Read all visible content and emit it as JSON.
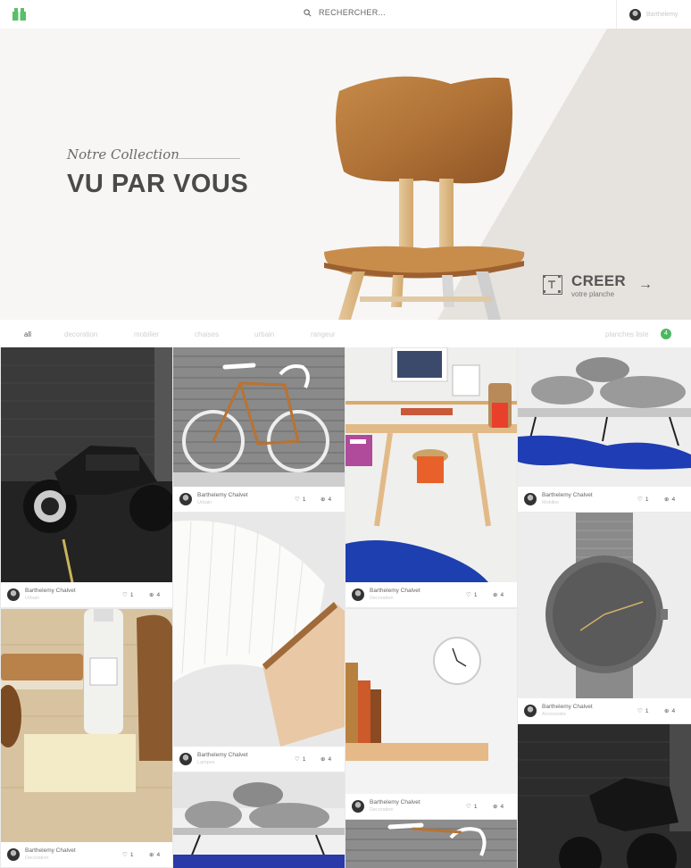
{
  "header": {
    "search_label": "RECHERCHER...",
    "user_name": "Barthelemy",
    "icons": {
      "logo": "gift-logo-icon",
      "search": "search-icon",
      "avatar": "user-avatar"
    }
  },
  "hero": {
    "subtitle": "Notre Collection",
    "title": "VU PAR VOUS",
    "cta_title": "CREER",
    "cta_subtitle": "votre planche",
    "cta_arrow": "→"
  },
  "filters": {
    "items": [
      "all",
      "decoration",
      "mobilier",
      "chaises",
      "urbain",
      "rangeur"
    ],
    "active": "all",
    "boards_label": "planches liste",
    "boards_count": "4"
  },
  "colors": {
    "accent_green": "#4cb85f",
    "hero_bg": "#f7f6f5",
    "hero_triangle": "#e6e3df"
  },
  "cards": [
    {
      "image": "black motorcycle in dark garage",
      "author": "Barthelemy Chalvet",
      "category": "Urbain",
      "likes": "1",
      "pins": "4"
    },
    {
      "image": "copper fixie bicycle",
      "author": "Barthelemy Chalvet",
      "category": "Urbain",
      "likes": "1",
      "pins": "4"
    },
    {
      "image": "wooden desk with stool",
      "author": "Barthelemy Chalvet",
      "category": "Decoration",
      "likes": "1",
      "pins": "4"
    },
    {
      "image": "pebble shaped sofa on blue rug",
      "author": "Barthelemy Chalvet",
      "category": "Mobilier",
      "likes": "1",
      "pins": "4"
    },
    {
      "image": "grooming brushes and bottle",
      "author": "Barthelemy Chalvet",
      "category": "Decoration",
      "likes": "1",
      "pins": "4"
    },
    {
      "image": "folding book lamp",
      "author": "Barthelemy Chalvet",
      "category": "Lampes",
      "likes": "1",
      "pins": "4"
    },
    {
      "image": "wall clock and shelf",
      "author": "Barthelemy Chalvet",
      "category": "Decoration",
      "likes": "1",
      "pins": "4"
    },
    {
      "image": "grey wrist watch",
      "author": "Barthelemy Chalvet",
      "category": "Accessoire",
      "likes": "1",
      "pins": "4"
    }
  ]
}
